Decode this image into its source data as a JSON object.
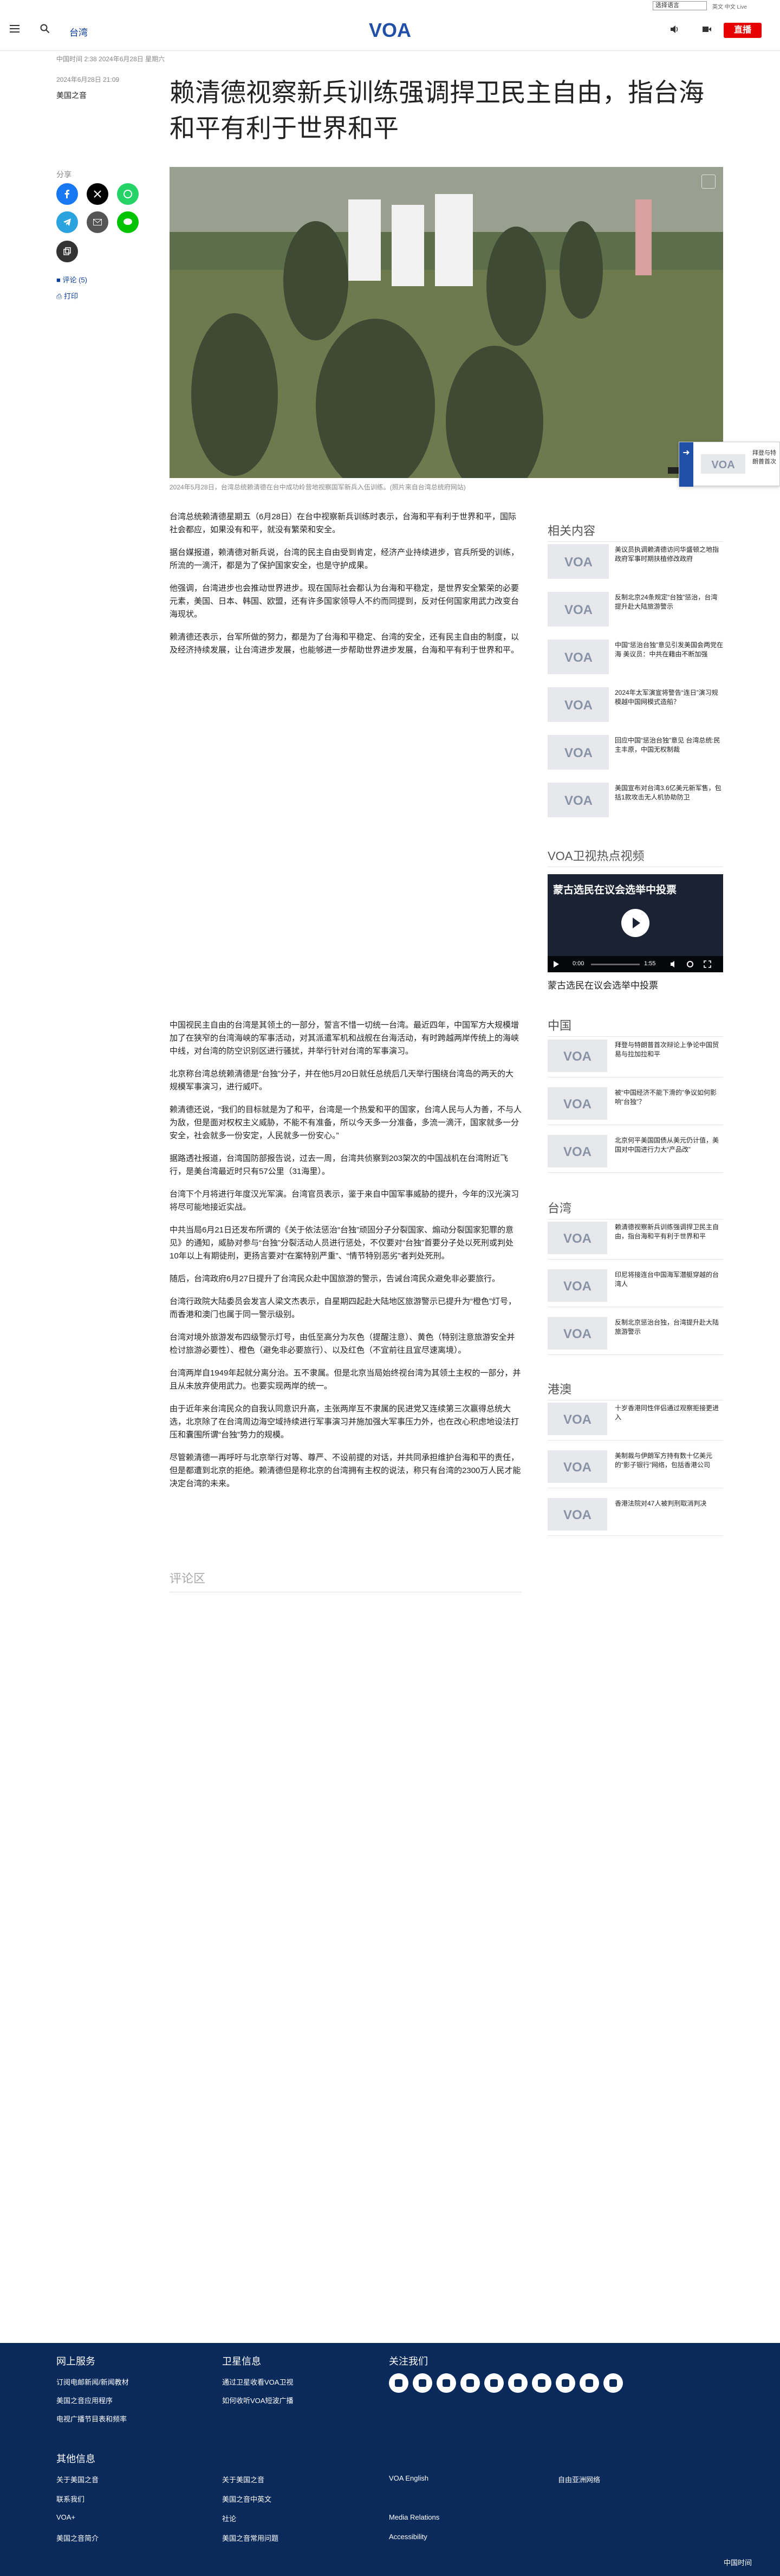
{
  "topbar": {
    "lang_select": "选择语言",
    "links": "英文 中文 Live"
  },
  "header": {
    "section": "台湾",
    "live": "直播",
    "logo": "VOA"
  },
  "article": {
    "meta": "中国时间 2:38 2024年6月28日 星期六",
    "date": "2024年6月28日 21:09",
    "category": "美国之音",
    "title": "赖清德视察新兵训练强调捍卫民主自由，指台海和平有利于世界和平",
    "share_label": "分享",
    "comment_link": "评论 (5)",
    "print_link": "打印",
    "caption": "2024年5月28日，台湾总统赖清德在台中成功岭营地视察国军新兵入伍训练。(照片来自台湾总统府网站)",
    "paragraphs_a": [
      "台湾总统赖清德星期五（6月28日）在台中视察新兵训练时表示，台海和平有利于世界和平，国际社会都应，如果没有和平，就没有繁荣和安全。",
      "据台媒报道，赖清德对新兵说，台湾的民主自由受到肯定，经济产业持续进步，官兵所受的训练，所流的一滴汗，都是为了保护国家安全，也是守护成果。",
      "他强调，台湾进步也会推动世界进步。现在国际社会都认为台海和平稳定，是世界安全繁荣的必要元素，美国、日本、韩国、欧盟，还有许多国家领导人不约而同提到，反对任何国家用武力改变台海现状。",
      "赖清德还表示，台军所做的努力，都是为了台海和平稳定、台湾的安全，还有民主自由的制度，以及经济持续发展，让台湾进步发展，也能够进一步帮助世界进步发展，台海和平有利于世界和平。"
    ],
    "paragraphs_b": [
      "中国视民主自由的台湾是其领土的一部分，誓言不惜一切统一台湾。最近四年，中国军方大规模增加了在狭窄的台湾海峡的军事活动，对其派遣军机和战舰在台海活动，有时跨越两岸传统上的海峡中线，对台湾的防空识别区进行骚扰，并举行针对台湾的军事演习。",
      "北京称台湾总统赖清德是“台独”分子，并在他5月20日就任总统后几天举行围绕台湾岛的两天的大规模军事演习，进行威吓。",
      "赖清德还说，“我们的目标就是为了和平，台湾是一个热爱和平的国家，台湾人民与人为善，不与人为敌，但是面对权权主义威胁，不能不有准备，所以今天多一分准备，多流一滴汗，国家就多一分安全，社会就多一份安定，人民就多一份安心。”",
      "据路透社报道，台湾国防部报告说，过去一周，台湾共侦察到203架次的中国战机在台湾附近飞行，是美台湾最近时只有57公里（31海里）。",
      "台湾下个月将进行年度汉光军演。台湾官员表示，鉴于来自中国军事威胁的提升，今年的汉光演习将尽可能地接近实战。",
      "中共当局6月21日还发布所谓的《关于依法惩治“台独”顽固分子分裂国家、煽动分裂国家犯罪的意见》的通知，威胁对参与“台独”分裂活动人员进行惩处，不仅要对“台独”首要分子处以死刑或判处10年以上有期徒刑，更扬言要对“在案特别严重”、“情节特别恶劣”者判处死刑。",
      "随后，台湾政府6月27日提升了台湾民众赴中国旅游的警示，告诫台湾民众避免非必要旅行。",
      "台湾行政院大陆委员会发言人梁文杰表示，自星期四起赴大陆地区旅游警示已提升为“橙色”灯号，而香港和澳门也属于同一警示级别。",
      "台湾对境外旅游发布四级警示灯号，由低至高分为灰色（提醒注意）、黄色（特别注意旅游安全并检讨旅游必要性）、橙色（避免非必要旅行）、以及红色（不宜前往且宜尽速离境）。",
      "台湾两岸自1949年起就分离分治。五不隶属。但是北京当局始终视台湾为其领土主权的一部分，并且从未放弃使用武力。也要实现两岸的统一。",
      "由于近年来台湾民众的自我认同意识升高，主张两岸互不隶属的民进党又连续第三次赢得总统大选，北京除了在台湾周边海空域持续进行军事演习并施加强大军事压力外，也在改心积虑地设法打压和囊围所谓“台独”势力的规模。",
      "尽管赖清德一再呼吁与北京举行对等、尊严、不设前提的对话，并共同承担维护台海和平的责任，但是都遭到北京的拒绝。赖清德但是称北京的台湾拥有主权的说法，称只有台湾的2300万人民才能决定台湾的未来。"
    ],
    "comments_heading": "评论区"
  },
  "sidebar": {
    "related_heading": "相关内容",
    "related": [
      "美议员执调赖清德访问华盛顿之地指政府军事时期扶植修改政府",
      "反制北京24条规定“台独”惩治，台湾提升赴大陆旅游警示",
      "中国“惩治台独”意见引发美国会两党在海 美议员：中共在藉由不断加强",
      "2024年太军演宣将警告“连日”演习规模越中国网模式造船？",
      "回应中国“惩治台独”意见 台湾总统:民主丰原，中国无权制裁",
      "美国宣布对台湾3.6亿美元新军售，包括1款攻击无人机协助防卫"
    ],
    "video_heading": "VOA卫视热点视频",
    "video": {
      "title": "蒙古选民在议会选举中投票",
      "time_a": "0:00",
      "time_b": "1:55",
      "caption": "蒙古选民在议会选举中投票"
    },
    "china_heading": "中国",
    "china": [
      "拜登与特朗普首次辩论上争论中国贸易与拉加拉和平",
      "被“中国经济不能下滑的”争议如何影响“台独”？",
      "北京何平美国国债从美元仍计值，美国对中国进行力大“产品改”"
    ],
    "taiwan_heading": "台湾",
    "taiwan": [
      "赖清德视察新兵训练强调捍卫民主自由，指台海和平有利于世界和平",
      "印尼将接连台中国海军潜艇穿越的台湾人",
      "反制北京惩治台独，台湾提升赴大陆旅游警示"
    ],
    "hk_heading": "港澳",
    "hk": [
      "十岁香港同性伴侣通过观察拒接更进入",
      "美制裁与伊朗军方持有数十亿美元的“影子银行”网络，包括香港公司",
      "香港法院对47人被判刑取消判决"
    ]
  },
  "float_card": {
    "text": "拜登与特朗普首次辩论"
  },
  "footer": {
    "col1_heading": "网上服务",
    "col1": [
      "订阅电邮新闻/新闻教材",
      "美国之音应用程序",
      "电视广播节目表和频率"
    ],
    "col2_heading": "卫星信息",
    "col2": [
      "通过卫星收看VOA卫视",
      "如何收听VOA短波广播"
    ],
    "col3_heading": "关注我们",
    "other_heading": "其他信息",
    "other": [
      [
        "关于美国之音",
        "关于美国之音",
        "VOA English",
        "自由亚洲网络"
      ],
      [
        "联系我们",
        "美国之音中英文",
        "",
        ""
      ],
      [
        "VOA+",
        "社论",
        "Media Relations",
        ""
      ],
      [
        "美国之音简介",
        "美国之音常用问题",
        "Accessibility",
        ""
      ]
    ],
    "copyright": "中国时间"
  }
}
